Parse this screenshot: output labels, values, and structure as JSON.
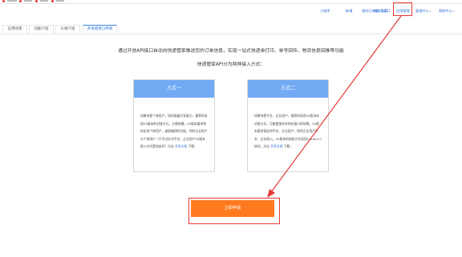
{
  "colors": {
    "accent_blue": "#2b6bd6",
    "card_header": "#72aaf4",
    "button_orange": "#ff7a1f",
    "annotation_red": "#e53935"
  },
  "topnav": {
    "items": [
      "小程序",
      "新增",
      "我的订单量：1251",
      "授权额度",
      "应用管理",
      "管理中心",
      "帮助中心"
    ],
    "highlighted": "应用管理"
  },
  "tabs": [
    "应用场景",
    "功能介绍",
    "价格介绍",
    "开发者接口申请"
  ],
  "active_tab": "开发者接口申请",
  "intro": {
    "line1": "通过开放API接口自动向快递管家推送您的订单信息，实现一站式快递单打印、单号回传、物流信息回推等功能",
    "line2": "快递管家API分为两种接入方式："
  },
  "methods": [
    {
      "title": "方式一",
      "desc": "如果你是个体用户，同时具备开发能力，推荐你采用V5版本的对接方式，方便快捷。V5版本要求你的支持个体用户，桌面端同时对接，同时企业用户与个体用户（只不过针对平台、企业用户V5版本接入方式更加友好）点击",
      "link": "开发文档",
      "suffix": "下载；"
    },
    {
      "title": "方式二",
      "desc": "如果你是平台、企业用户，推荐你采用V5版本的对接方式，可能更加符合你在接口的场景。V5版本要求接支持平台、企业用户，同时企业用户平台、企业接入。V5版本的授权方式采用OAuth2.0协议，点击",
      "link": "开发文档",
      "suffix": "下载；"
    }
  ],
  "apply_button": "立即申请"
}
